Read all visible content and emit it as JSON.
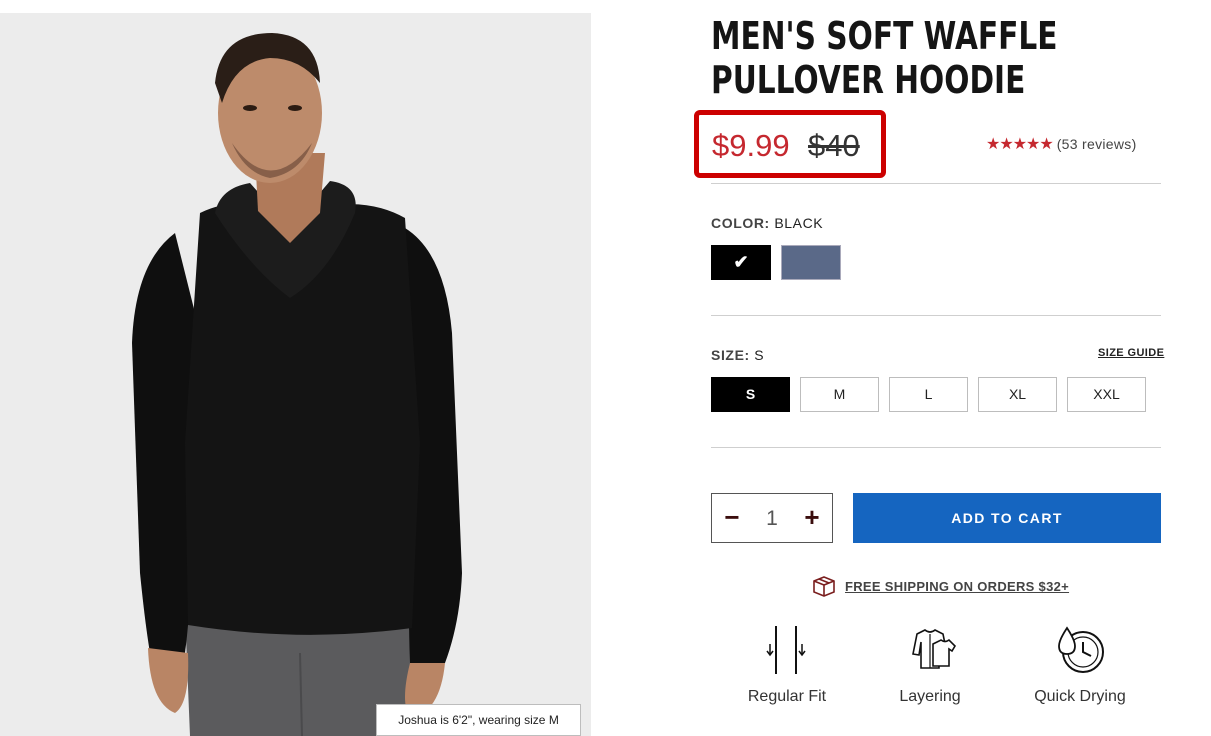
{
  "product": {
    "title": "MEN'S SOFT WAFFLE PULLOVER HOODIE",
    "image_caption": "Joshua is 6'2\", wearing size M"
  },
  "price": {
    "sale": "$9.99",
    "original": "$40",
    "sale_color": "#c5282f",
    "highlight_color": "#cc0000"
  },
  "rating": {
    "stars": "★★★★★",
    "value": 5,
    "reviews_text": "(53 reviews)"
  },
  "color": {
    "label": "COLOR:",
    "selected": "BLACK",
    "swatches": [
      {
        "name": "BLACK",
        "hex": "#000000",
        "selected": true
      },
      {
        "name": "Blue",
        "hex": "#5a6988",
        "selected": false
      }
    ]
  },
  "size": {
    "label": "SIZE:",
    "selected": "S",
    "guide_label": "SIZE GUIDE",
    "options": [
      "S",
      "M",
      "L",
      "XL",
      "XXL"
    ]
  },
  "quantity": {
    "minus": "−",
    "value": "1",
    "plus": "+"
  },
  "cart": {
    "button_label": "ADD TO CART",
    "button_color": "#1565c0"
  },
  "shipping": {
    "text": "FREE SHIPPING ON ORDERS $32+",
    "icon": "box-icon"
  },
  "features": [
    {
      "label": "Regular Fit",
      "icon": "regular-fit-icon"
    },
    {
      "label": "Layering",
      "icon": "layering-icon"
    },
    {
      "label": "Quick Drying",
      "icon": "quick-drying-icon"
    }
  ]
}
